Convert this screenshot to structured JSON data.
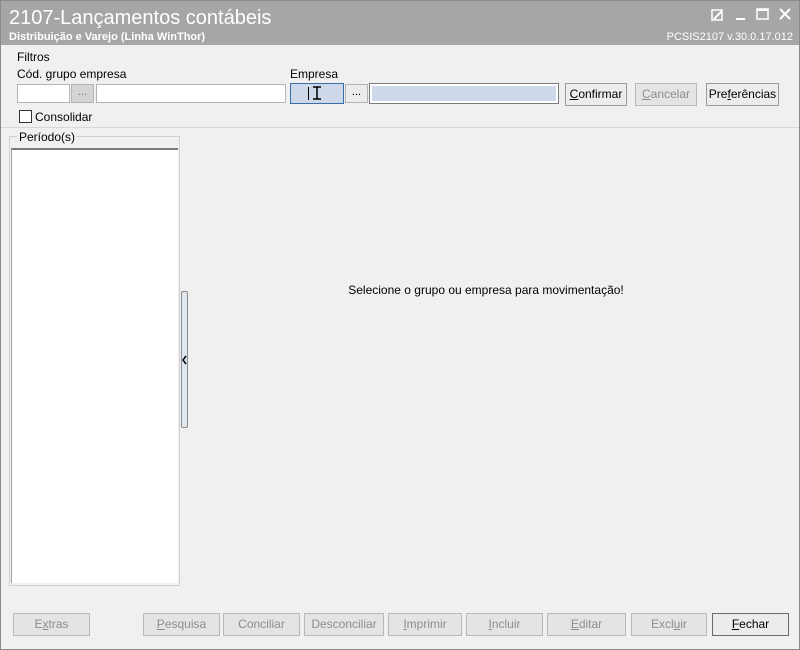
{
  "window": {
    "title": "2107-Lançamentos contábeis",
    "subtitle": "Distribuição e Varejo (Linha WinThor)",
    "version": "PCSIS2107  v.30.0.17.012"
  },
  "filters": {
    "group_label": "Filtros",
    "cod_grupo_label": "Cód. grupo empresa",
    "cod_grupo_value": "",
    "grupo_desc_value": "",
    "empresa_label": "Empresa",
    "empresa_value": "",
    "empresa_desc_value": "",
    "browse_label": "...",
    "consolidar_label": "Consolidar",
    "consolidar_checked": false
  },
  "buttons": {
    "confirmar": {
      "mnemonic": "C",
      "rest": "onfirmar"
    },
    "cancelar": {
      "mnemonic": "C",
      "rest": "ancelar"
    },
    "preferencias": {
      "pre": "Pre",
      "mnemonic": "f",
      "rest": "erências"
    }
  },
  "periodos": {
    "label": "Período(s)",
    "items": []
  },
  "main": {
    "message": "Selecione o grupo ou empresa para movimentação!"
  },
  "footer": {
    "extras": {
      "pre": "E",
      "mnemonic": "x",
      "rest": "tras"
    },
    "pesquisa": {
      "pre": "",
      "mnemonic": "P",
      "rest": "esquisa"
    },
    "conciliar": {
      "label": "Conciliar"
    },
    "desconciliar": {
      "label": "Desconciliar"
    },
    "imprimir": {
      "pre": "",
      "mnemonic": "I",
      "rest": "mprimir"
    },
    "incluir": {
      "pre": "",
      "mnemonic": "I",
      "rest": "ncluir"
    },
    "editar": {
      "pre": "",
      "mnemonic": "E",
      "rest": "ditar"
    },
    "excluir": {
      "pre": "Excl",
      "mnemonic": "u",
      "rest": "ir"
    },
    "fechar": {
      "pre": "",
      "mnemonic": "F",
      "rest": "echar"
    }
  },
  "colors": {
    "titlebar": "#a6a6a6",
    "window_bg": "#f0f0f0",
    "focus_field": "#cdd9ea",
    "disabled_text": "#8d8d8d"
  }
}
